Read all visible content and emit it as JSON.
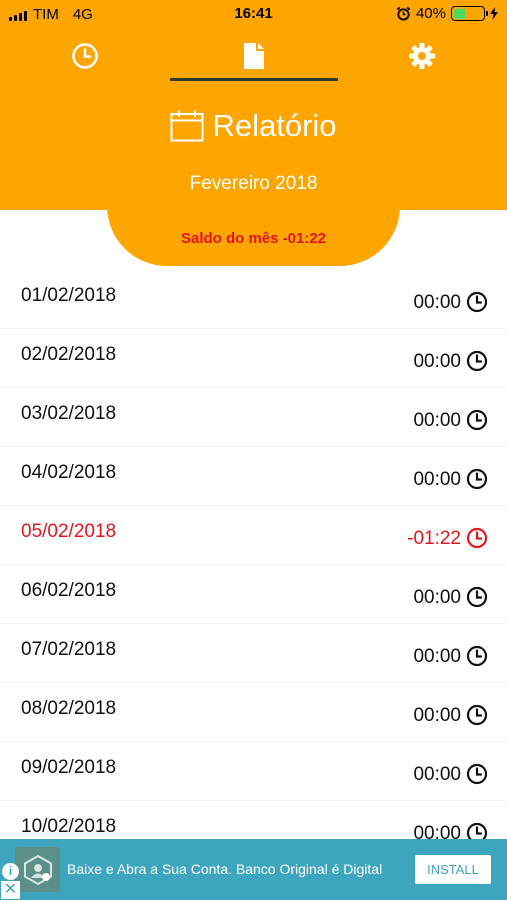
{
  "status_bar": {
    "carrier": "TIM",
    "network": "4G",
    "time": "16:41",
    "battery_percent": "40%",
    "battery_level": 0.4
  },
  "tabs": [
    {
      "name": "tab-clock",
      "icon": "clock-icon"
    },
    {
      "name": "tab-report",
      "icon": "document-icon",
      "selected": true
    },
    {
      "name": "tab-settings",
      "icon": "gear-icon"
    }
  ],
  "header": {
    "title": "Relatório",
    "title_icon": "calendar-icon",
    "month": "Fevereiro 2018",
    "balance": "Saldo do mês -01:22"
  },
  "colors": {
    "accent": "#FFA500",
    "negative": "#E8141C",
    "ad_background": "#3DA6BE"
  },
  "days": [
    {
      "date": "01/02/2018",
      "balance": "00:00",
      "negative": false
    },
    {
      "date": "02/02/2018",
      "balance": "00:00",
      "negative": false
    },
    {
      "date": "03/02/2018",
      "balance": "00:00",
      "negative": false
    },
    {
      "date": "04/02/2018",
      "balance": "00:00",
      "negative": false
    },
    {
      "date": "05/02/2018",
      "balance": "-01:22",
      "negative": true
    },
    {
      "date": "06/02/2018",
      "balance": "00:00",
      "negative": false
    },
    {
      "date": "07/02/2018",
      "balance": "00:00",
      "negative": false
    },
    {
      "date": "08/02/2018",
      "balance": "00:00",
      "negative": false
    },
    {
      "date": "09/02/2018",
      "balance": "00:00",
      "negative": false
    },
    {
      "date": "10/02/2018",
      "balance": "00:00",
      "negative": false
    }
  ],
  "ad": {
    "text": "Baixe e Abra a Sua Conta. Banco Original é Digital",
    "install_label": "INSTALL",
    "info_glyph": "i",
    "close_glyph": "✕"
  }
}
